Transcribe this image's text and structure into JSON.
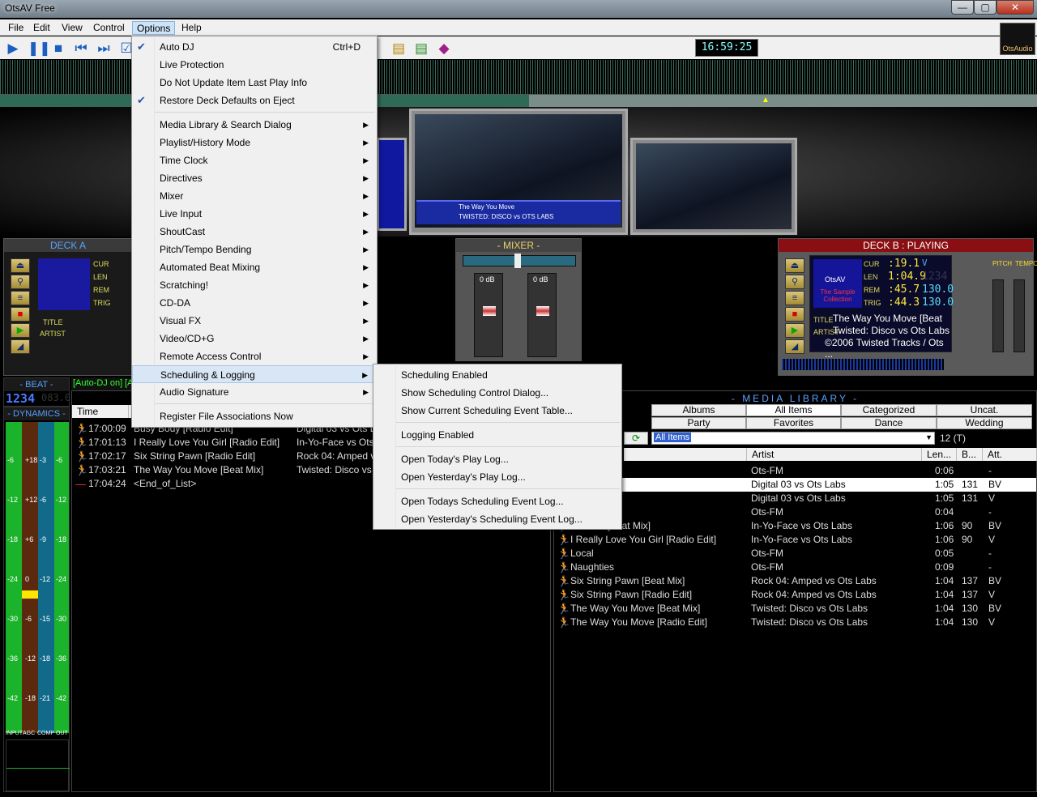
{
  "window": {
    "title": "OtsAV Free",
    "controls": [
      "—",
      "▢",
      "✕"
    ]
  },
  "menubar": [
    "File",
    "Edit",
    "View",
    "Control",
    "Options",
    "Help"
  ],
  "clock": "16:59:25",
  "logo": "OtsAudio",
  "video": {
    "caption1": "The Way You Move",
    "caption2": "TWISTED: DISCO vs OTS LABS"
  },
  "deck_a": {
    "title": "DECK A",
    "labels": [
      "CUR",
      "LEN",
      "REM",
      "TRIG",
      "TITLE",
      "ARTIST"
    ]
  },
  "mixer": {
    "title": "- MIXER -",
    "db": "0 dB"
  },
  "deck_b": {
    "title": "DECK B : PLAYING",
    "cur": ":19.1",
    "len": "1:04.9",
    "rem": ":45.7",
    "trig": ":44.3",
    "bpm1": "130.0",
    "bpm2": "130.0",
    "bpm3": "1234",
    "v": "V",
    "title_val": "The Way You Move [Beat ...",
    "artist_val": "Twisted: Disco vs Ots Labs",
    "copy_val": "©2006 Twisted Tracks / Ots ...",
    "art_name": "OtsAV",
    "art_text": "The Sample Collection",
    "pitch": "PITCH",
    "tempo": "TEMPO"
  },
  "beat": {
    "title": "- BEAT -",
    "value": "1234",
    "dim": "083.0"
  },
  "dynamics": {
    "title": "- DYNAMICS -",
    "scale_a": [
      "-6",
      "-12",
      "-18",
      "-24",
      "-30",
      "-36",
      "-42"
    ],
    "scale_b": [
      "+18",
      "+12",
      "+6",
      "0",
      "-6",
      "-12",
      "-18"
    ],
    "scale_c": [
      "-3",
      "-6",
      "-9",
      "-12",
      "-15",
      "-18",
      "-21"
    ],
    "footer": [
      "INPUT",
      "AGC",
      "COMP",
      "OUT"
    ]
  },
  "history": {
    "tabs": [
      "[Auto-DJ on]",
      "[A"
    ],
    "col_time": "Time",
    "rows": [
      {
        "time": "17:00:09",
        "title": "Busy Body [Radio Edit]",
        "artist": "Digital 03 vs Ots L"
      },
      {
        "time": "17:01:13",
        "title": "I Really Love You Girl [Radio Edit]",
        "artist": "In-Yo-Face vs Ots"
      },
      {
        "time": "17:02:17",
        "title": "Six String Pawn [Radio Edit]",
        "artist": "Rock 04: Amped v"
      },
      {
        "time": "17:03:21",
        "title": "The Way You Move [Beat Mix]",
        "artist": "Twisted: Disco vs"
      },
      {
        "time": "17:04:24",
        "title": "<End_of_List>",
        "artist": ""
      }
    ]
  },
  "library": {
    "title": "- MEDIA LIBRARY -",
    "cats_row1": [
      "Albums",
      "All Items",
      "Categorized",
      "Uncat."
    ],
    "cats_row2": [
      "Party",
      "Favorites",
      "Dance",
      "Wedding"
    ],
    "filter": "All Items",
    "count": "12 (T)",
    "cols": [
      "Artist",
      "Len...",
      "B...",
      "Att."
    ],
    "rows": [
      {
        "title": "",
        "artist": "Ots-FM",
        "len": "0:06",
        "bpm": "",
        "att": "-"
      },
      {
        "title": "Beat Mix]",
        "artist": "Digital 03 vs Ots Labs",
        "len": "1:05",
        "bpm": "131",
        "att": "BV"
      },
      {
        "title": "Radio Edit]",
        "artist": "Digital 03 vs Ots Labs",
        "len": "1:05",
        "bpm": "131",
        "att": "V"
      },
      {
        "title": "ky",
        "artist": "Ots-FM",
        "len": "0:04",
        "bpm": "",
        "att": "-"
      },
      {
        "title": "You Girl [Beat Mix]",
        "artist": "In-Yo-Face vs Ots Labs",
        "len": "1:06",
        "bpm": "90",
        "att": "BV"
      },
      {
        "title": "I Really Love You Girl [Radio Edit]",
        "artist": "In-Yo-Face vs Ots Labs",
        "len": "1:06",
        "bpm": "90",
        "att": "V"
      },
      {
        "title": "Local",
        "artist": "Ots-FM",
        "len": "0:05",
        "bpm": "",
        "att": "-"
      },
      {
        "title": "Naughties",
        "artist": "Ots-FM",
        "len": "0:09",
        "bpm": "",
        "att": "-"
      },
      {
        "title": "Six String Pawn [Beat Mix]",
        "artist": "Rock 04: Amped vs Ots Labs",
        "len": "1:04",
        "bpm": "137",
        "att": "BV"
      },
      {
        "title": "Six String Pawn [Radio Edit]",
        "artist": "Rock 04: Amped vs Ots Labs",
        "len": "1:04",
        "bpm": "137",
        "att": "V"
      },
      {
        "title": "The Way You Move [Beat Mix]",
        "artist": "Twisted: Disco vs Ots Labs",
        "len": "1:04",
        "bpm": "130",
        "att": "BV"
      },
      {
        "title": "The Way You Move [Radio Edit]",
        "artist": "Twisted: Disco vs Ots Labs",
        "len": "1:04",
        "bpm": "130",
        "att": "V"
      }
    ]
  },
  "options_menu": {
    "items": [
      {
        "label": "Auto DJ",
        "shortcut": "Ctrl+D",
        "checked": true
      },
      {
        "label": "Live Protection"
      },
      {
        "label": "Do Not Update Item Last Play Info"
      },
      {
        "label": "Restore Deck Defaults on Eject",
        "checked": true
      },
      {
        "label": "Media Library & Search Dialog",
        "sub": true
      },
      {
        "label": "Playlist/History Mode",
        "sub": true
      },
      {
        "label": "Time Clock",
        "sub": true
      },
      {
        "label": "Directives",
        "sub": true
      },
      {
        "label": "Mixer",
        "sub": true
      },
      {
        "label": "Live Input",
        "sub": true
      },
      {
        "label": "ShoutCast",
        "sub": true
      },
      {
        "label": "Pitch/Tempo Bending",
        "sub": true
      },
      {
        "label": "Automated Beat Mixing",
        "sub": true
      },
      {
        "label": "Scratching!",
        "sub": true
      },
      {
        "label": "CD-DA",
        "sub": true
      },
      {
        "label": "Visual FX",
        "sub": true
      },
      {
        "label": "Video/CD+G",
        "sub": true
      },
      {
        "label": "Remote Access Control",
        "sub": true
      },
      {
        "label": "Scheduling & Logging",
        "sub": true
      },
      {
        "label": "Audio Signature",
        "sub": true
      },
      {
        "label": "Register File Associations Now"
      }
    ]
  },
  "sched_menu": {
    "items": [
      "Scheduling Enabled",
      "Show Scheduling Control Dialog...",
      "Show Current Scheduling Event Table...",
      "Logging Enabled",
      "Open Today's Play Log...",
      "Open Yesterday's Play Log...",
      "Open Todays Scheduling Event Log...",
      "Open Yesterday's Scheduling Event Log..."
    ]
  }
}
